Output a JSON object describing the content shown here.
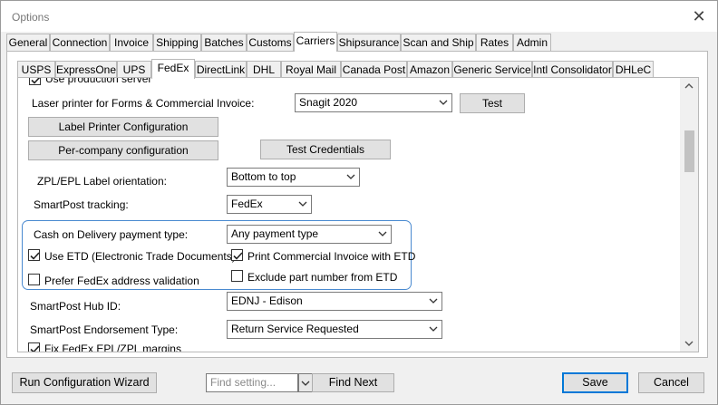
{
  "window": {
    "title": "Options"
  },
  "main_tabs": [
    "General",
    "Connection",
    "Invoice",
    "Shipping",
    "Batches",
    "Customs",
    "Carriers",
    "Shipsurance",
    "Scan and Ship",
    "Rates",
    "Admin"
  ],
  "main_tab_active": "Carriers",
  "carrier_tabs": [
    "USPS",
    "ExpressOne",
    "UPS",
    "FedEx",
    "DirectLink",
    "DHL",
    "Royal Mail",
    "Canada Post",
    "Amazon",
    "Generic Service",
    "Intl Consolidator",
    "DHLeC"
  ],
  "carrier_tab_active": "FedEx",
  "fedex": {
    "use_production_server_label": "Use production server",
    "laser_printer_label": "Laser printer for Forms & Commercial Invoice:",
    "laser_printer_value": "Snagit 2020",
    "test_button": "Test",
    "label_printer_config_button": "Label Printer Configuration",
    "per_company_config_button": "Per-company configuration",
    "test_credentials_button": "Test Credentials",
    "zpl_orientation_label": "ZPL/EPL Label orientation:",
    "zpl_orientation_value": "Bottom to top",
    "smartpost_tracking_label": "SmartPost tracking:",
    "smartpost_tracking_value": "FedEx",
    "cod_payment_label": "Cash on Delivery payment type:",
    "cod_payment_value": "Any payment type",
    "use_etd_label": "Use ETD (Electronic Trade Documents)",
    "use_etd_checked": true,
    "print_ci_etd_label": "Print Commercial Invoice with ETD",
    "print_ci_etd_checked": true,
    "prefer_address_validation_label": "Prefer FedEx address validation",
    "prefer_address_validation_checked": false,
    "exclude_part_number_label": "Exclude part number from ETD",
    "exclude_part_number_checked": false,
    "smartpost_hub_label": "SmartPost Hub ID:",
    "smartpost_hub_value": "EDNJ - Edison",
    "smartpost_endorsement_label": "SmartPost Endorsement Type:",
    "smartpost_endorsement_value": "Return Service Requested",
    "fix_margins_label": "Fix FedEx EPL/ZPL margins",
    "fix_margins_checked": true
  },
  "footer": {
    "run_wizard_button": "Run Configuration Wizard",
    "find_placeholder": "Find setting...",
    "find_next_button": "Find Next",
    "save_button": "Save",
    "cancel_button": "Cancel"
  },
  "colors": {
    "accent": "#0078d7",
    "group_border": "#4a8ad0"
  }
}
